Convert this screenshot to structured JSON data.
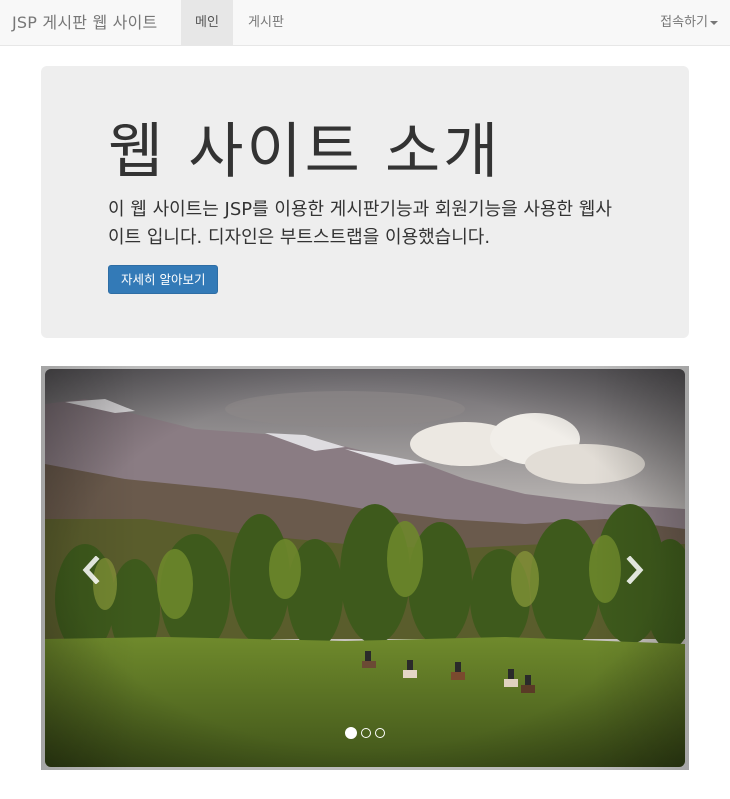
{
  "navbar": {
    "brand": "JSP 게시판 웹 사이트",
    "items": [
      {
        "label": "메인",
        "active": true
      },
      {
        "label": "게시판",
        "active": false
      }
    ],
    "dropdown_label": "접속하기"
  },
  "jumbotron": {
    "title": "웹 사이트 소개",
    "description": "이 웹 사이트는 JSP를 이용한 게시판기능과 회원기능을 사용한 웹사이트 입니다. 디자인은 부트스트랩을 이용했습니다.",
    "button_label": "자세히 알아보기"
  },
  "carousel": {
    "slide_count": 3,
    "active_index": 0,
    "prev_icon": "chevron-left-icon",
    "next_icon": "chevron-right-icon"
  },
  "colors": {
    "navbar_bg": "#f8f8f8",
    "jumbotron_bg": "#eeeeee",
    "primary": "#337ab7"
  }
}
